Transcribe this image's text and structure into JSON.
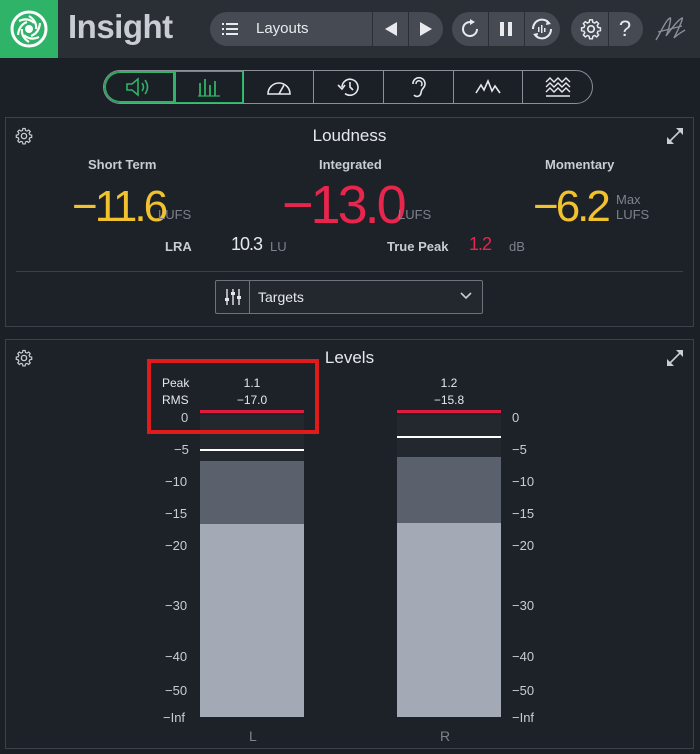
{
  "app": {
    "title": "Insight"
  },
  "toolbar": {
    "layouts_label": "Layouts",
    "help_label": "?"
  },
  "tabs": [
    {
      "icon": "speaker-icon"
    },
    {
      "icon": "bars-icon"
    },
    {
      "icon": "gauge-icon"
    },
    {
      "icon": "history-icon"
    },
    {
      "icon": "ear-icon"
    },
    {
      "icon": "waveform-icon"
    },
    {
      "icon": "spectrogram-icon"
    }
  ],
  "loudness": {
    "title": "Loudness",
    "short_term": {
      "label": "Short Term",
      "value": "−11.6",
      "unit": "LUFS"
    },
    "integrated": {
      "label": "Integrated",
      "value": "−13.0",
      "unit": "LUFS"
    },
    "momentary": {
      "label": "Momentary",
      "value": "−6.2",
      "unit_line1": "Max",
      "unit_line2": "LUFS"
    },
    "lra": {
      "label": "LRA",
      "value": "10.3",
      "unit": "LU"
    },
    "true_peak": {
      "label": "True Peak",
      "value": "1.2",
      "unit": "dB"
    },
    "targets_label": "Targets"
  },
  "levels": {
    "title": "Levels",
    "peak_label": "Peak",
    "rms_label": "RMS",
    "left": {
      "label": "L",
      "peak": "1.1",
      "rms": "−17.0"
    },
    "right": {
      "label": "R",
      "peak": "1.2",
      "rms": "−15.8"
    },
    "scale_left": [
      "0",
      "−5",
      "−10",
      "−15",
      "−20",
      "−30",
      "−40",
      "−50",
      "−Inf"
    ],
    "scale_right": [
      "0",
      "−5",
      "−10",
      "−15",
      "−20",
      "−30",
      "−40",
      "−50",
      "−Inf"
    ]
  },
  "colors": {
    "accent_green": "#2fb368",
    "short_term_yellow": "#f2c12e",
    "integrated_red": "#e8254d",
    "peak_red": "#e0193f"
  }
}
